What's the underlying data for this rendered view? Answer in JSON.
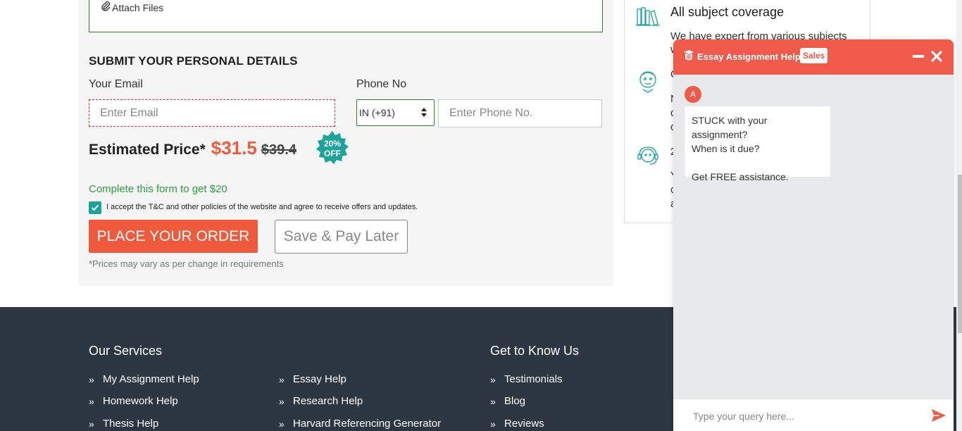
{
  "form": {
    "attach_label": "Attach Files",
    "section_title": "SUBMIT YOUR PERSONAL DETAILS",
    "email_label": "Your Email",
    "email_placeholder": "Enter Email",
    "phone_label": "Phone No",
    "country_code": "IN (+91)",
    "phone_placeholder": "Enter Phone No.",
    "price_label": "Estimated Price*",
    "price_now": "$31.5",
    "price_old": "$39.4",
    "discount_line1": "20%",
    "discount_line2": "OFF",
    "promo_text": "Complete this form to get $20",
    "tnc_text": "I accept the T&C and other policies of the website and agree to receive offers and updates.",
    "tnc_checked": true,
    "order_button": "PLACE YOUR ORDER",
    "later_button": "Save & Pay Later",
    "note": "*Prices may vary as per change in requirements"
  },
  "info_card": {
    "heading": "All subject coverage",
    "text_line1": "We have expert from various subjects",
    "fragments": [
      "w",
      "C",
      "N",
      "c",
      "c",
      "2",
      "Y",
      "c",
      "a"
    ]
  },
  "footer": {
    "services_heading": "Our Services",
    "about_heading": "Get to Know Us",
    "services_col1": [
      "My Assignment Help",
      "Homework Help",
      "Thesis Help"
    ],
    "services_col2": [
      "Essay Help",
      "Research Help",
      "Harvard Referencing Generator"
    ],
    "about_links": [
      "Testimonials",
      "Blog",
      "Reviews"
    ]
  },
  "chat": {
    "title": "Essay Assignment Help",
    "badge": "Sales",
    "avatar_letter": "A",
    "message_line1": "STUCK with your assignment?",
    "message_line2": "When is it due?",
    "message_line3": "Get FREE assistance.",
    "input_placeholder": "Type your query here..."
  },
  "colors": {
    "accent": "#ef5a3c",
    "chat_header": "#ef5a4b",
    "teal": "#1ba39c",
    "footer_bg": "#2d3741",
    "promo_green": "#2e9e3e"
  }
}
